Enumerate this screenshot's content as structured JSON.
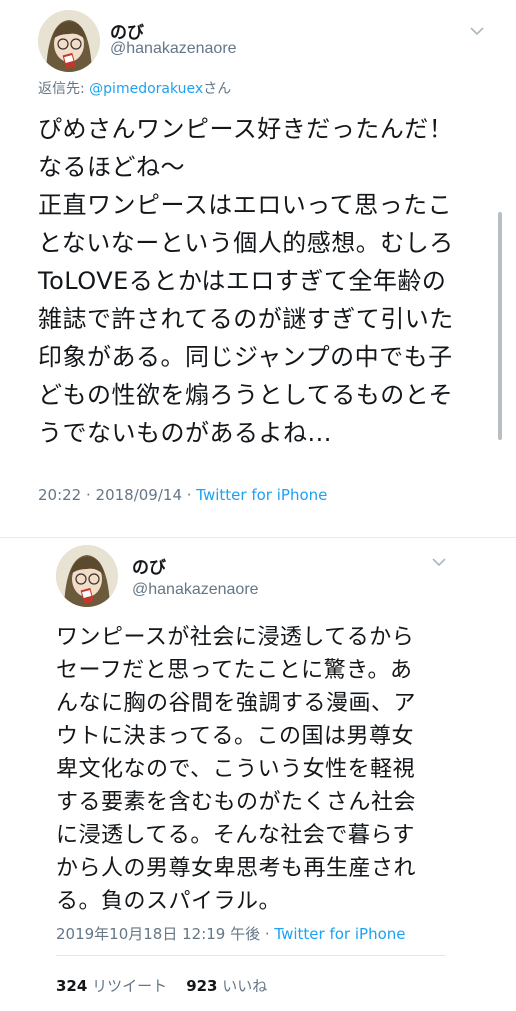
{
  "tweet1": {
    "display_name": "のび",
    "handle": "@hanakazenaore",
    "reply_to_prefix": "返信先: ",
    "reply_to_user": "@pimedorakuex",
    "reply_to_suffix": "さん",
    "lines": [
      "ぴめさんワンピース好きだったんだ！",
      "なるほどね〜",
      "正直ワンピースはエロいって思ったこ",
      "とないなーという個人的感想。むしろ",
      "ToLOVEるとかはエロすぎて全年齢の",
      "雑誌で許されてるのが謎すぎて引いた",
      "印象がある。同じジャンプの中でも子",
      "どもの性欲を煽ろうとしてるものとそ",
      "うでないものがあるよね..."
    ],
    "timestamp": "20:22 · 2018/09/14 · ",
    "source": "Twitter for iPhone"
  },
  "tweet2": {
    "display_name": "のび",
    "handle": "@hanakazenaore",
    "lines": [
      "ワンピースが社会に浸透してるから",
      "セーフだと思ってたことに驚き。あ",
      "んなに胸の谷間を強調する漫画、ア",
      "ウトに決まってる。この国は男尊女",
      "卑文化なので、こういう女性を軽視",
      "する要素を含むものがたくさん社会",
      "に浸透してる。そんな社会で暮らす",
      "から人の男尊女卑思考も再生産され",
      "る。負のスパイラル。"
    ],
    "timestamp": "2019年10月18日 12:19 午後 · ",
    "source": "Twitter for iPhone",
    "retweet_count": "324",
    "retweet_label": "リツイート",
    "like_count": "923",
    "like_label": "いいね"
  },
  "colors": {
    "link": "#1da1f2",
    "secondary_text": "#657786",
    "primary_text": "#14171a"
  },
  "icons": [
    "avatar",
    "chevron-down-icon"
  ]
}
